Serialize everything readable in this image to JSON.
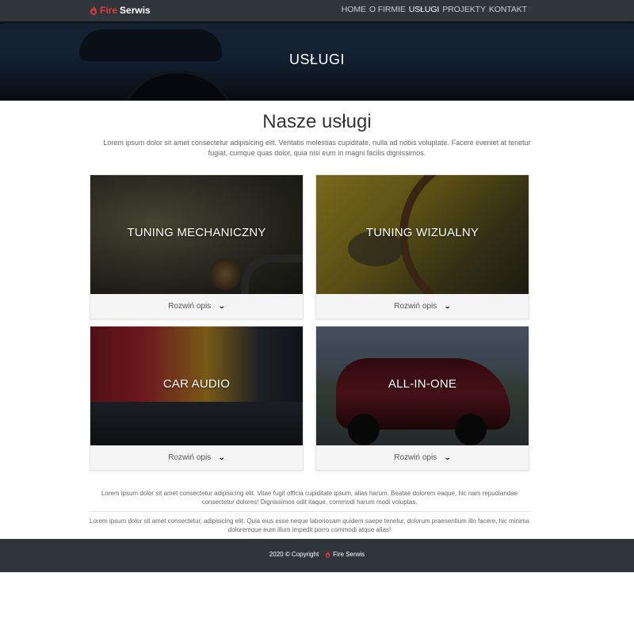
{
  "brand": {
    "fire": "Fire",
    "serwis": "Serwis",
    "logo_color": "#e23a3a"
  },
  "nav": {
    "items": [
      {
        "label": "HOME"
      },
      {
        "label": "O FIRMIE"
      },
      {
        "label": "USŁUGI"
      },
      {
        "label": "PROJEKTY"
      },
      {
        "label": "KONTAKT"
      }
    ],
    "active": "USŁUGI"
  },
  "hero": {
    "title": "USŁUGI"
  },
  "services_section": {
    "title": "Nasze usługi",
    "intro": "Lorem ipsum dolor sit amet consectetur adipisicing elit. Veritatis molestias cupiditate, nulla ad nobis voluptate. Facere eveniet at tenetur fugiat, cumque quas dolor, quia nisi eum in magni facilis dignissimos."
  },
  "cards": [
    {
      "title": "TUNING MECHANICZNY",
      "action": "Rozwiń opis"
    },
    {
      "title": "TUNING WIZUALNY",
      "action": "Rozwiń opis"
    },
    {
      "title": "CAR AUDIO",
      "action": "Rozwiń opis"
    },
    {
      "title": "ALL-IN-ONE",
      "action": "Rozwiń opis"
    }
  ],
  "chevron_icon": "double-chevron-down",
  "bottom_text": {
    "p1": "Lorem ipsum dolor sit amet consectetur adipisicing elit. Vitae fugit officia cupiditate ipsum, alias harum. Beatae dolorem eaque, hic nam repudiandae consectetur dolores! Dignissimos odit itaque, commodi harum modi voluptas.",
    "p2": "Lorem ipsum dolor sit amet consectetur, adipisicing elit. Quia eius esse neque laboriosam quidem saepe tenetur, dolorum praesentium illo facere, hic minima doloremque eum illum impedit porro commodi atque alias!"
  },
  "footer": {
    "copyright": "2020 © Copyright",
    "brand": "Fire Serwis"
  },
  "colors": {
    "navbar_bg": "#31353c",
    "accent": "#e23a3a"
  }
}
